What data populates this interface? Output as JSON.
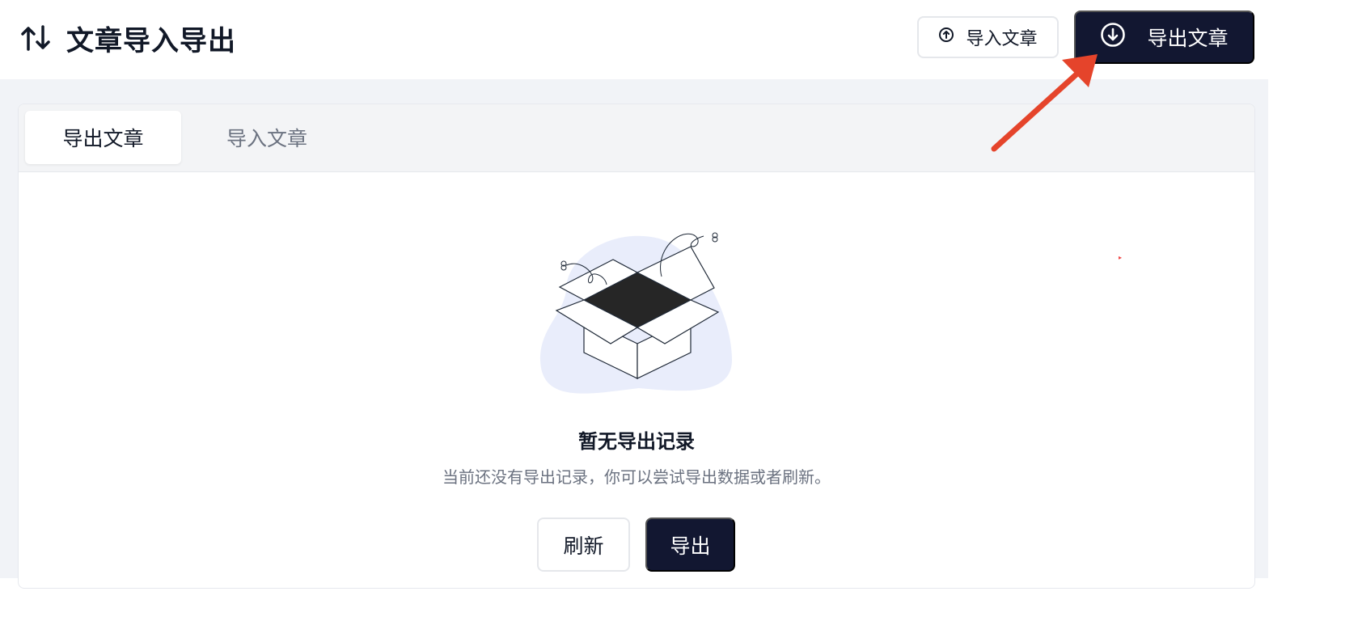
{
  "header": {
    "title": "文章导入导出",
    "import_button": "导入文章",
    "export_button": "导出文章"
  },
  "tabs": [
    {
      "label": "导出文章",
      "active": true
    },
    {
      "label": "导入文章",
      "active": false
    }
  ],
  "empty_state": {
    "title": "暂无导出记录",
    "description": "当前还没有导出记录，你可以尝试导出数据或者刷新。",
    "refresh_button": "刷新",
    "export_button": "导出"
  },
  "icons": {
    "title_icon": "sort-arrows-icon",
    "import_icon": "upload-circle-icon",
    "export_icon": "download-circle-icon",
    "illustration": "empty-box-illustration"
  },
  "colors": {
    "primary": "#121731",
    "annotation": "#e5442b",
    "blob": "#e9edfb"
  }
}
